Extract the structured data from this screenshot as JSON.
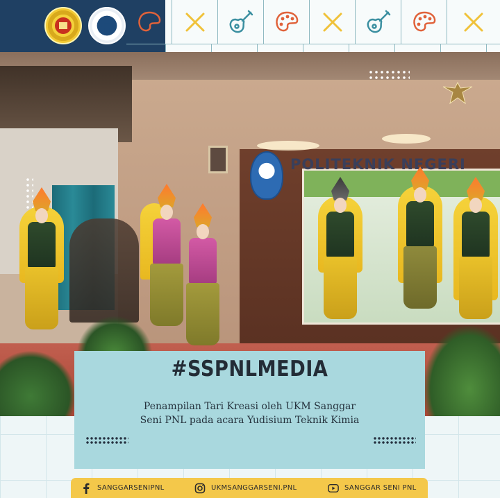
{
  "header": {
    "logos": [
      {
        "icon": "institution-seal-icon",
        "accent": "#f2c933"
      },
      {
        "icon": "ukm-emblem-icon",
        "accent": "#1d4a7a"
      }
    ],
    "strip_icons": [
      "palette-icon",
      "cross-icon",
      "guitar-icon",
      "palette-icon",
      "cross-icon",
      "guitar-icon",
      "palette-icon",
      "cross-icon"
    ],
    "colors": {
      "navy": "#1f4063",
      "orange": "#e0623a",
      "yellow": "#f0c23a",
      "teal": "#3a8fa0"
    }
  },
  "photo": {
    "wall_sign": "POLITEKNIK NEGERI"
  },
  "card": {
    "hashtag": "#SSPNLMEDIA",
    "caption_line1": "Penampilan Tari Kreasi oleh UKM Sanggar",
    "caption_line2": "Seni PNL pada acara Yudisium Teknik Kimia",
    "background": "#a9d8de"
  },
  "footer": {
    "facebook": "SANGGARSENIPNL",
    "instagram": "UKMSANGGARSENI.PNL",
    "youtube": "SANGGAR SENI PNL",
    "background": "#f4c84a"
  }
}
